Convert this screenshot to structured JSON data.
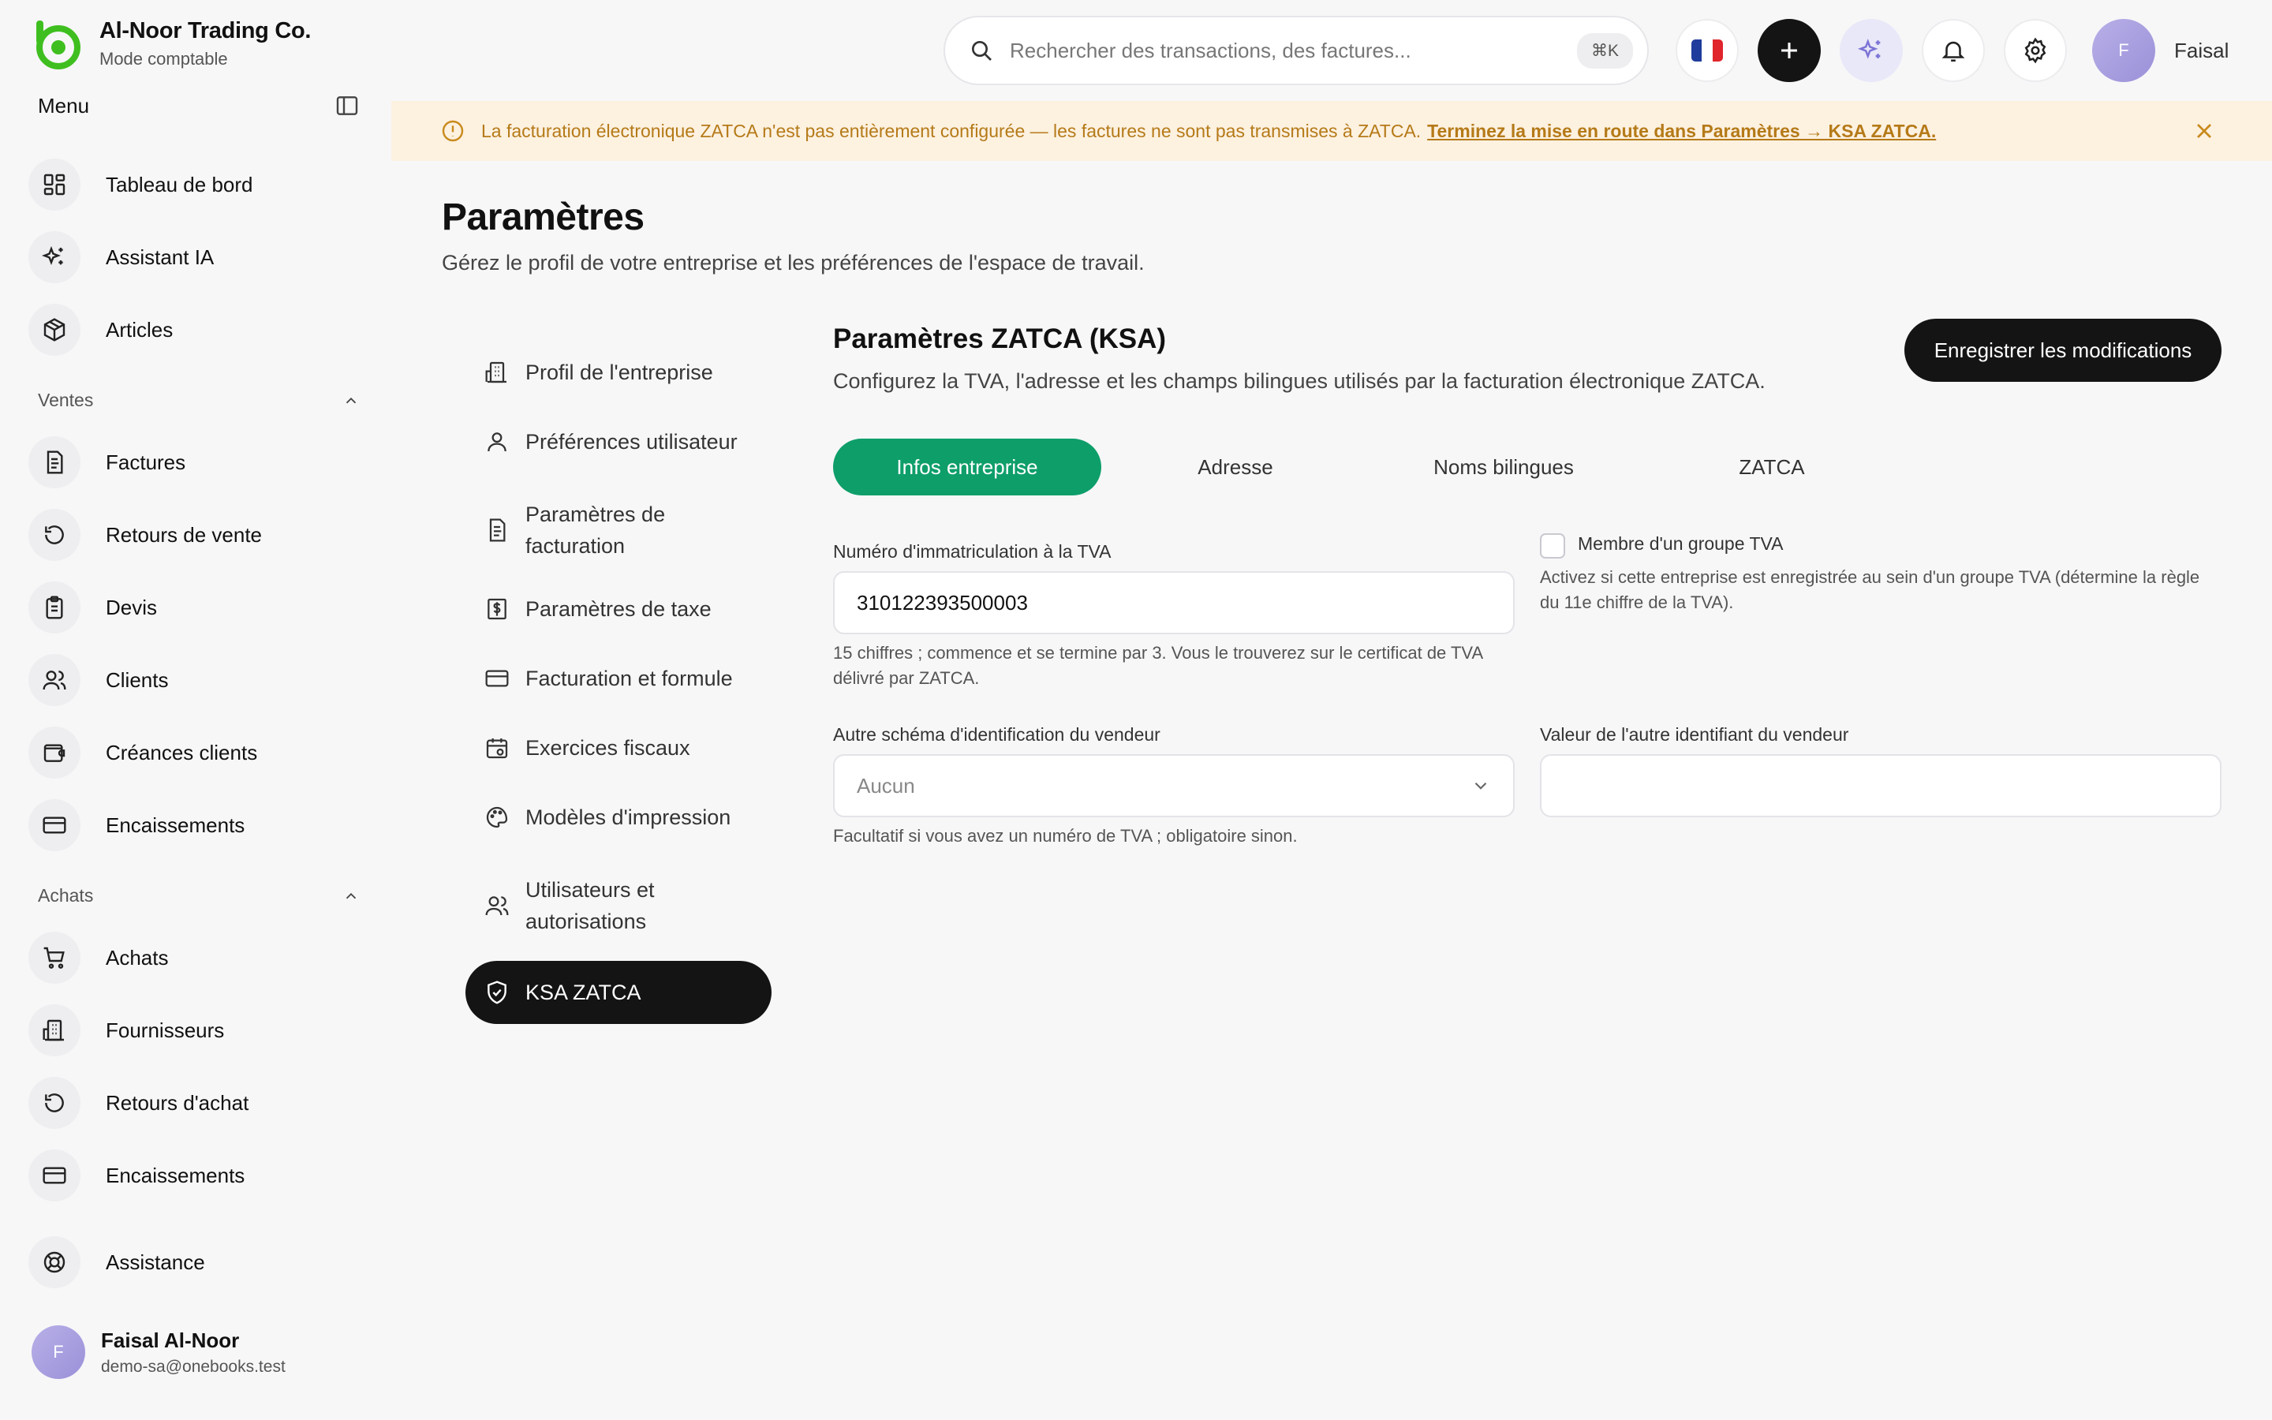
{
  "brand": {
    "name": "Al-Noor Trading Co.",
    "mode": "Mode comptable"
  },
  "sidebar": {
    "menu_title": "Menu",
    "items_top": [
      {
        "label": "Tableau de bord",
        "icon": "dashboard-icon"
      },
      {
        "label": "Assistant IA",
        "icon": "sparkles-icon"
      },
      {
        "label": "Articles",
        "icon": "box-icon"
      }
    ],
    "sales_title": "Ventes",
    "sales_items": [
      {
        "label": "Factures",
        "icon": "invoice-icon"
      },
      {
        "label": "Retours de vente",
        "icon": "return-icon"
      },
      {
        "label": "Devis",
        "icon": "clipboard-icon"
      },
      {
        "label": "Clients",
        "icon": "users-icon"
      },
      {
        "label": "Créances clients",
        "icon": "wallet-icon"
      },
      {
        "label": "Encaissements",
        "icon": "card-icon"
      }
    ],
    "purchases_title": "Achats",
    "purchase_items": [
      {
        "label": "Achats",
        "icon": "cart-icon"
      },
      {
        "label": "Fournisseurs",
        "icon": "building-icon"
      },
      {
        "label": "Retours d'achat",
        "icon": "return-icon"
      },
      {
        "label": "Encaissements",
        "icon": "card-icon"
      }
    ],
    "support": {
      "label": "Assistance",
      "icon": "lifebuoy-icon"
    },
    "user": {
      "initial": "F",
      "name": "Faisal Al-Noor",
      "email": "demo-sa@onebooks.test"
    }
  },
  "topbar": {
    "search_placeholder": "Rechercher des transactions, des factures...",
    "shortcut": "⌘K",
    "user_initial": "F",
    "user_name": "Faisal"
  },
  "banner": {
    "text": "La facturation électronique ZATCA n'est pas entièrement configurée — les factures ne sont pas transmises à ZATCA.",
    "link": "Terminez la mise en route dans Paramètres → KSA ZATCA."
  },
  "page": {
    "title": "Paramètres",
    "subtitle": "Gérez le profil de votre entreprise et les préférences de l'espace de travail."
  },
  "settings_nav": [
    {
      "label": "Profil de l'entreprise",
      "icon": "building-icon"
    },
    {
      "label": "Préférences utilisateur",
      "icon": "user-icon"
    },
    {
      "label": "Paramètres de facturation",
      "icon": "invoice-icon"
    },
    {
      "label": "Paramètres de taxe",
      "icon": "tax-icon"
    },
    {
      "label": "Facturation et formule",
      "icon": "card-icon"
    },
    {
      "label": "Exercices fiscaux",
      "icon": "calendar-icon"
    },
    {
      "label": "Modèles d'impression",
      "icon": "palette-icon"
    },
    {
      "label": "Utilisateurs et autorisations",
      "icon": "users-icon"
    },
    {
      "label": "KSA ZATCA",
      "icon": "shield-check-icon",
      "active": true
    }
  ],
  "section": {
    "title": "Paramètres ZATCA (KSA)",
    "description": "Configurez la TVA, l'adresse et les champs bilingues utilisés par la facturation électronique ZATCA.",
    "save_label": "Enregistrer les modifications"
  },
  "tabs": [
    {
      "label": "Infos entreprise",
      "active": true
    },
    {
      "label": "Adresse"
    },
    {
      "label": "Noms bilingues"
    },
    {
      "label": "ZATCA"
    }
  ],
  "form": {
    "vat_label": "Numéro d'immatriculation à la TVA",
    "vat_value": "310122393500003",
    "vat_help": "15 chiffres ; commence et se termine par 3. Vous le trouverez sur le certificat de TVA délivré par ZATCA.",
    "group_label": "Membre d'un groupe TVA",
    "group_checked": false,
    "group_help": "Activez si cette entreprise est enregistrée au sein d'un groupe TVA (détermine la règle du 11e chiffre de la TVA).",
    "scheme_label": "Autre schéma d'identification du vendeur",
    "scheme_value": "Aucun",
    "scheme_help": "Facultatif si vous avez un numéro de TVA ; obligatoire sinon.",
    "other_id_label": "Valeur de l'autre identifiant du vendeur",
    "other_id_value": ""
  },
  "colors": {
    "accent": "#0e9e6a",
    "brand": "#3fbf1f",
    "dark": "#141414",
    "warning_bg": "#fdf1e0",
    "warning_text": "#b57a18"
  }
}
